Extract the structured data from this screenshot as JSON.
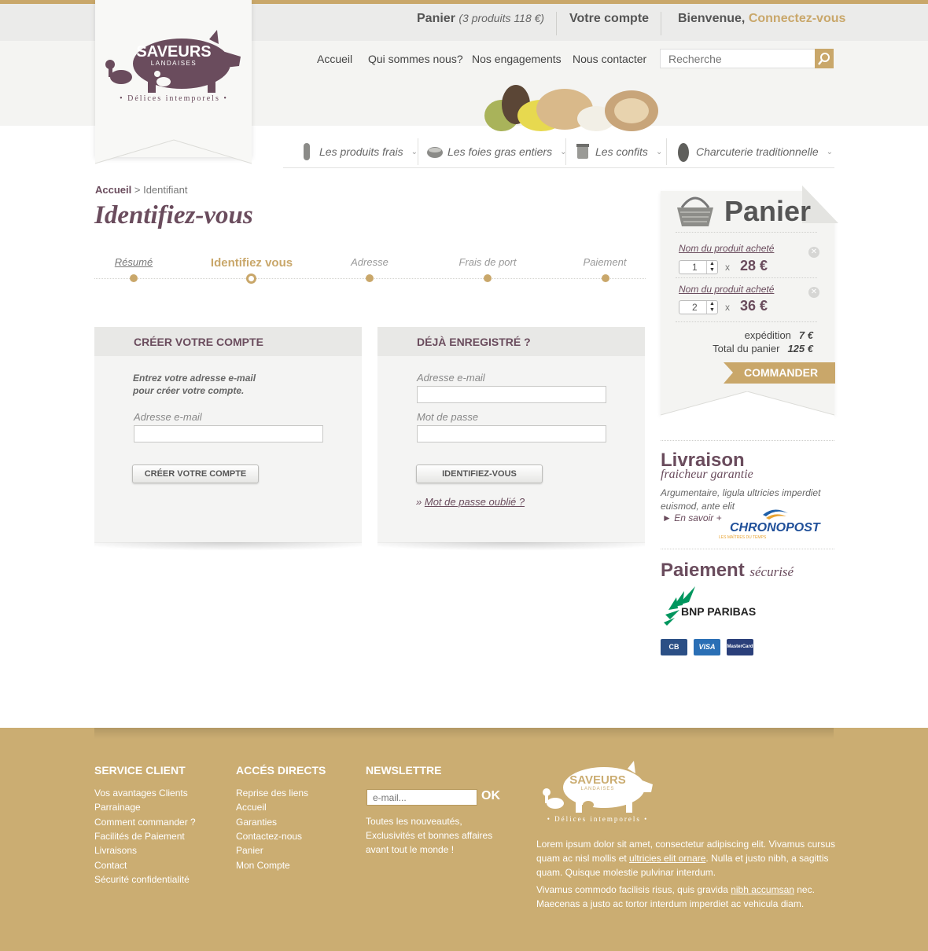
{
  "topbar": {
    "cart_label": "Panier",
    "cart_summary": "(3 produits 118 €)",
    "account_label": "Votre compte",
    "welcome_label": "Bienvenue,",
    "connect_label": "Connectez-vous"
  },
  "logo": {
    "name": "SAVEURS",
    "sub": "LANDAISES",
    "tagline": "• Délices intemporels •"
  },
  "nav": {
    "items": [
      "Accueil",
      "Qui sommes nous?",
      "Nos engagements",
      "Nous contacter"
    ],
    "search_placeholder": "Recherche"
  },
  "categories": [
    {
      "label": "Les produits frais",
      "icon": "sausage-icon"
    },
    {
      "label": "Les foies gras entiers",
      "icon": "terrine-icon"
    },
    {
      "label": "Les confits",
      "icon": "jar-icon"
    },
    {
      "label": "Charcuterie traditionnelle",
      "icon": "charcuterie-icon"
    }
  ],
  "breadcrumb": {
    "home": "Accueil",
    "separator": ">",
    "current": "Identifiant"
  },
  "page_title": "Identifiez-vous",
  "steps": [
    {
      "label": "Résumé",
      "state": "done"
    },
    {
      "label": "Identifiez vous",
      "state": "active"
    },
    {
      "label": "Adresse",
      "state": "todo"
    },
    {
      "label": "Frais de port",
      "state": "todo"
    },
    {
      "label": "Paiement",
      "state": "todo"
    }
  ],
  "create_account": {
    "title": "CRÉER VOTRE COMPTE",
    "intro_line1": "Entrez votre adresse e-mail",
    "intro_line2": "pour créer votre compte.",
    "email_label": "Adresse e-mail",
    "button": "CRÉER VOTRE COMPTE"
  },
  "login": {
    "title": "DÉJÀ ENREGISTRÉ ?",
    "email_label": "Adresse e-mail",
    "password_label": "Mot de passe",
    "button": "IDENTIFIEZ-VOUS",
    "forgot_prefix": "»",
    "forgot_link": "Mot de passe oublié ?"
  },
  "cart": {
    "title": "Panier",
    "items": [
      {
        "name": "Nom du produit acheté",
        "qty": "1",
        "times": "x",
        "price": "28 €"
      },
      {
        "name": "Nom du produit acheté",
        "qty": "2",
        "times": "x",
        "price": "36 €"
      }
    ],
    "shipping_label": "expédition",
    "shipping_value": "7 €",
    "total_label": "Total du panier",
    "total_value": "125 €",
    "order_button": "COMMANDER"
  },
  "delivery": {
    "title": "Livraison",
    "subtitle": "fraicheur garantie",
    "text": "Argumentaire, ligula ultricies imperdiet euismod, ante elit",
    "more": "► En savoir +",
    "partner": "CHRONOPOST",
    "partner_tagline": "LES MAÎTRES DU TEMPS"
  },
  "payment": {
    "title": "Paiement",
    "subtitle": "sécurisé",
    "bank": "BNP PARIBAS",
    "cards": [
      "CB",
      "VISA",
      "MasterCard"
    ]
  },
  "footer": {
    "service": {
      "title": "SERVICE CLIENT",
      "links": [
        "Vos avantages Clients",
        "Parrainage",
        "Comment commander ?",
        "Facilités de Paiement",
        "Livraisons",
        "Contact",
        "Sécurité confidentialité"
      ]
    },
    "direct": {
      "title": "ACCÉS DIRECTS",
      "links": [
        "Reprise des liens",
        "Accueil",
        "Garanties",
        "Contactez-nous",
        "Panier",
        "Mon Compte"
      ]
    },
    "newsletter": {
      "title": "NEWSLETTRE",
      "placeholder": "e-mail...",
      "ok": "OK",
      "text": "Toutes les nouveautés, Exclusivités et bonnes affaires avant tout le monde !"
    },
    "para1_a": "Lorem ipsum dolor sit amet, consectetur adipiscing elit. Vivamus cursus quam ac nisl mollis et ",
    "para1_link": "ultricies elit ornare",
    "para1_b": ". Nulla et justo nibh, a sagittis quam. Quisque molestie pulvinar interdum.",
    "para2_a": "Vivamus commodo facilisis risus, quis gravida ",
    "para2_link": "nibh accumsan",
    "para2_b": " nec. Maecenas a justo ac tortor interdum imperdiet ac vehicula diam."
  },
  "colors": {
    "brand": "#6a4c5d",
    "accent": "#c9a76a"
  }
}
